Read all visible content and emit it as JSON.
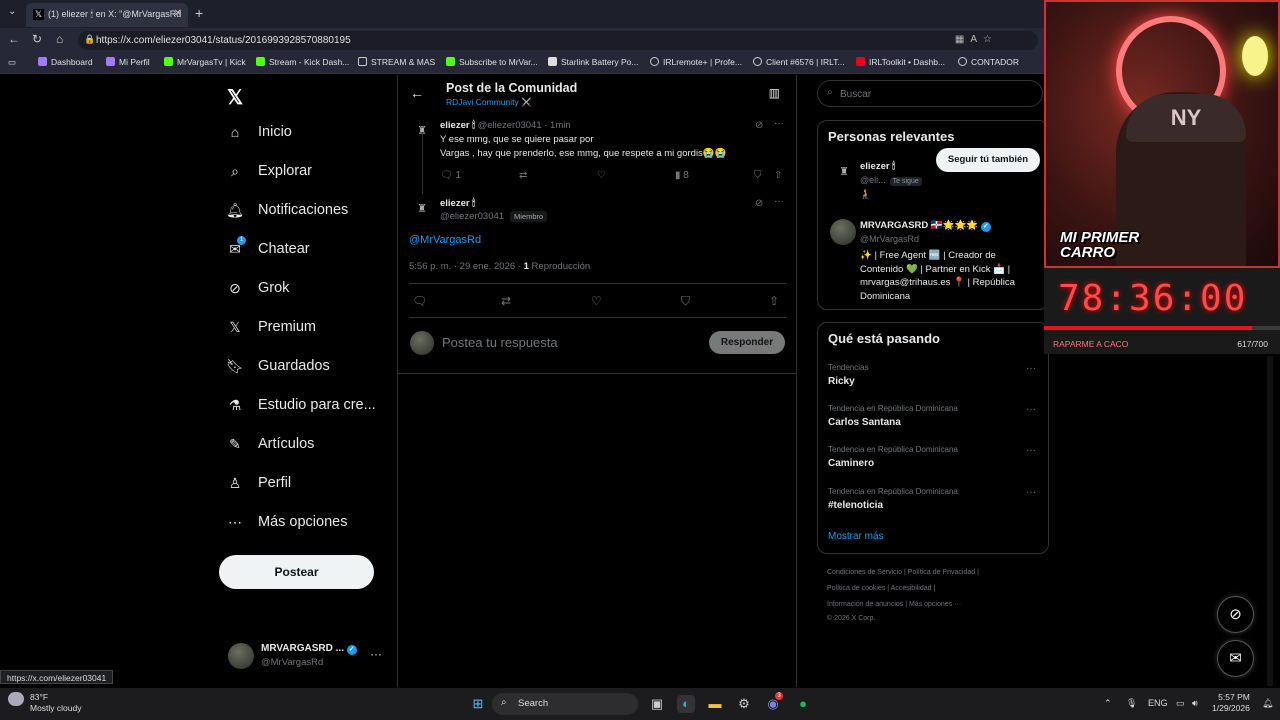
{
  "browser": {
    "tab_title": "(1) eliezer 🕯 en X: \"@MrVargasRd",
    "url": "https://x.com/eliezer03041/status/2016993928570880195",
    "bookmarks": [
      "Dashboard",
      "Mi Perfil",
      "MrVargasTv | Kick",
      "Stream - Kick Dash...",
      "STREAM & MAS",
      "Subscribe to MrVar...",
      "Starlink Battery Po...",
      "IRLremote+ | Profe...",
      "Client #6576 | IRLT...",
      "IRLToolkit • Dashb...",
      "CONTADOR"
    ],
    "status_url": "https://x.com/eliezer03041"
  },
  "sidebar": {
    "items": [
      {
        "label": "Inicio",
        "icon": "home-icon"
      },
      {
        "label": "Explorar",
        "icon": "search-icon"
      },
      {
        "label": "Notificaciones",
        "icon": "bell-icon"
      },
      {
        "label": "Chatear",
        "icon": "mail-icon"
      },
      {
        "label": "Grok",
        "icon": "grok-icon"
      },
      {
        "label": "Premium",
        "icon": "x-premium-icon"
      },
      {
        "label": "Guardados",
        "icon": "bookmark-icon"
      },
      {
        "label": "Estudio para cre...",
        "icon": "flask-icon"
      },
      {
        "label": "Artículos",
        "icon": "article-icon"
      },
      {
        "label": "Perfil",
        "icon": "person-icon"
      },
      {
        "label": "Más opciones",
        "icon": "more-icon"
      }
    ],
    "chat_badge": "1",
    "post_button": "Postear",
    "account": {
      "name": "MRVARGASRD ...",
      "handle": "@MrVargasRd"
    }
  },
  "header": {
    "title": "Post de la Comunidad",
    "subtitle": "RDJavi Community ⚔️"
  },
  "parent_tweet": {
    "name": "eliezer 🕯",
    "handle": "@eliezer03041",
    "time": "· 1min",
    "text_line1": "Y ese mmg, que se quiere pasar por",
    "text_line2": "Vargas , hay que prenderlo, ese mmg, que respete a mi gordis😭😭",
    "replies": "1",
    "views": "8"
  },
  "main_tweet": {
    "name": "eliezer 🕯",
    "handle": "@eliezer03041",
    "badge": "Miembro",
    "mention": "@MrVargasRd",
    "time": "5:56 p. m. · 29 ene. 2026 · ",
    "views_count": "1",
    "views_label": " Reproducción"
  },
  "reply": {
    "placeholder": "Postea tu respuesta",
    "button": "Responder"
  },
  "search": {
    "placeholder": "Buscar"
  },
  "relevant": {
    "title": "Personas relevantes",
    "p1": {
      "name": "eliezer 🕯",
      "handle": "@eli...",
      "follows": "Te sigue",
      "button": "Seguir tú también",
      "extra": "🧎"
    },
    "p2": {
      "name": "MRVARGASRD 🇩🇴🌟🌟🌟",
      "handle": "@MrVargasRd",
      "bio": "✨ | Free Agent 🆓 | Creador de Contenido 💚 | Partner en Kick 📩 | mrvargas@trihaus.es 📍 | República Dominicana"
    }
  },
  "trends": {
    "title": "Qué está pasando",
    "items": [
      {
        "category": "Tendencias",
        "name": "Ricky"
      },
      {
        "category": "Tendencia en República Dominicana",
        "name": "Carlos Santana"
      },
      {
        "category": "Tendencia en República Dominicana",
        "name": "Caminero"
      },
      {
        "category": "Tendencia en República Dominicana",
        "name": "#telenoticia"
      }
    ],
    "show_more": "Mostrar más"
  },
  "footer": {
    "line1": "Condiciones de Servicio  |  Política de Privacidad  |",
    "line2": "Política de cookies  |  Accesibilidad  |",
    "line3": "Información de anuncios  |  Más opciones ···",
    "line4": "© 2026 X Corp."
  },
  "overlay": {
    "cap_logo": "NY",
    "sticker": "MI PRIMER\nCARRO",
    "timer": "78:36:00",
    "goal_label": "RAPARME A CACO",
    "goal_count": "617/700",
    "goal_progress": 0.88
  },
  "taskbar": {
    "temp": "83°F",
    "weather": "Mostly cloudy",
    "search": "Search",
    "lang": "ENG",
    "time": "5:57 PM",
    "date": "1/29/2026",
    "notif_badge": "3"
  }
}
